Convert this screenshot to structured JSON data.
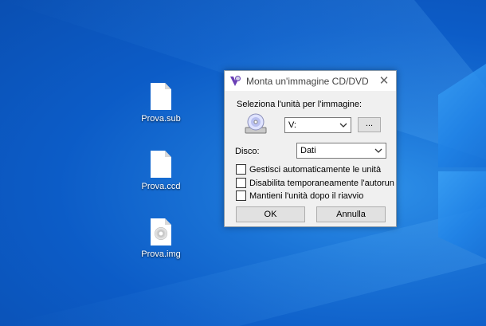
{
  "desktop": {
    "icons": [
      {
        "label": "Prova.sub",
        "icon": "file-icon"
      },
      {
        "label": "Prova.ccd",
        "icon": "file-icon"
      },
      {
        "label": "Prova.img",
        "icon": "disc-image-icon"
      }
    ]
  },
  "dialog": {
    "title": "Monta un'immagine CD/DVD",
    "close_symbol": "✕",
    "drive_prompt": "Seleziona l'unità per l'immagine:",
    "drive_value": "V:",
    "browse_label": "...",
    "disc_label": "Disco:",
    "disc_value": "Dati",
    "options": [
      {
        "label": "Gestisci automaticamente le unità",
        "checked": false
      },
      {
        "label": "Disabilita temporaneamente l'autorun",
        "checked": false
      },
      {
        "label": "Mantieni l'unità dopo il riavvio",
        "checked": false
      }
    ],
    "ok_label": "OK",
    "cancel_label": "Annulla"
  },
  "colors": {
    "desktop_bg": "#0c5cc7",
    "dialog_bg": "#f0f0f0",
    "button_bg": "#e1e1e1"
  }
}
